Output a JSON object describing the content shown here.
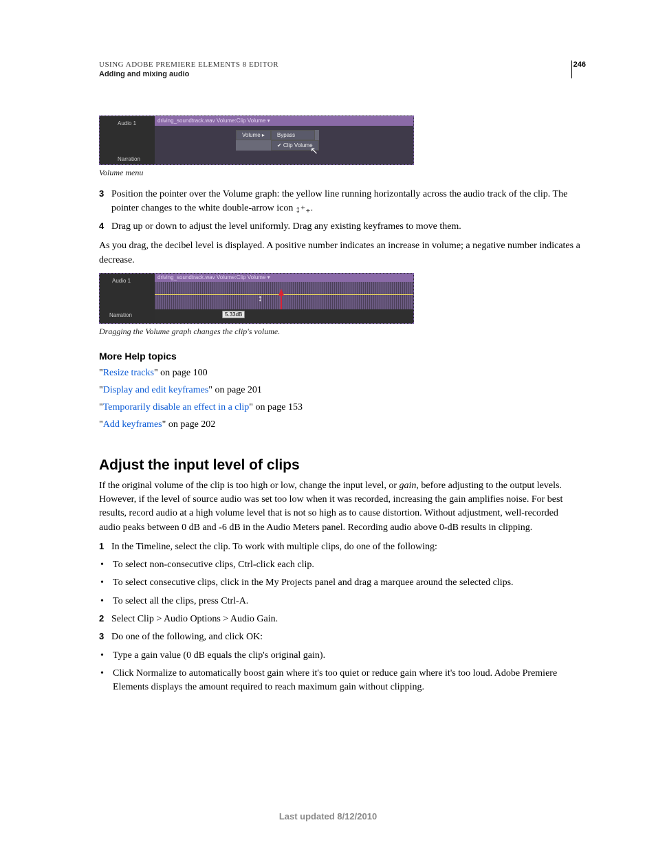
{
  "header": {
    "title": "USING ADOBE PREMIERE ELEMENTS 8 EDITOR",
    "subtitle": "Adding and mixing audio",
    "page_number": "246"
  },
  "fig1": {
    "track_audio": "Audio 1",
    "track_narration": "Narration",
    "clip_label": "driving_soundtrack.wav Volume:Clip Volume ▾",
    "menu_volume": "Volume ▸",
    "menu_bypass": "Bypass",
    "menu_clip_volume": "Clip Volume",
    "caption": "Volume menu"
  },
  "step3": {
    "num": "3",
    "text_a": "Position the pointer over the Volume graph: the yellow line running horizontally across the audio track of the clip. The pointer changes to the white double-arrow icon ",
    "text_b": "."
  },
  "step4": {
    "num": "4",
    "text": "Drag up or down to adjust the level uniformly. Drag any existing keyframes to move them."
  },
  "para_decibel": "As you drag, the decibel level is displayed. A positive number indicates an increase in volume; a negative number indicates a decrease.",
  "fig2": {
    "track_audio": "Audio 1",
    "track_narration": "Narration",
    "clip_label": "driving_soundtrack.wav Volume:Clip Volume ▾",
    "db": "5.33dB",
    "caption": "Dragging the Volume graph changes the clip's volume."
  },
  "help": {
    "heading": "More Help topics",
    "items": [
      {
        "link": "Resize tracks",
        "rest": "\" on page 100"
      },
      {
        "link": "Display and edit keyframes",
        "rest": "\" on page 201"
      },
      {
        "link": "Temporarily disable an effect in a clip",
        "rest": "\" on page 153"
      },
      {
        "link": "Add keyframes",
        "rest": "\" on page 202"
      }
    ],
    "quote": "\""
  },
  "section2": {
    "heading": "Adjust the input level of clips",
    "intro_a": "If the original volume of the clip is too high or low, change the input level, or ",
    "intro_gain": "gain",
    "intro_b": ", before adjusting to the output levels. However, if the level of source audio was set too low when it was recorded, increasing the gain amplifies noise. For best results, record audio at a high volume level that is not so high as to cause distortion. Without adjustment, well-recorded audio peaks between 0 dB and -6 dB in the Audio Meters panel. Recording audio above 0-dB results in clipping.",
    "steps": [
      {
        "n": "1",
        "t": "In the Timeline, select the clip. To work with multiple clips, do one of the following:"
      },
      {
        "b": "•",
        "t": "To select non-consecutive clips, Ctrl-click each clip."
      },
      {
        "b": "•",
        "t": "To select consecutive clips, click in the My Projects panel and drag a marquee around the selected clips."
      },
      {
        "b": "•",
        "t": "To select all the clips, press Ctrl-A."
      },
      {
        "n": "2",
        "t": "Select Clip > Audio Options > Audio Gain."
      },
      {
        "n": "3",
        "t": "Do one of the following, and click OK:"
      },
      {
        "b": "•",
        "t": "Type a gain value (0 dB equals the clip's original gain)."
      },
      {
        "b": "•",
        "t": "Click Normalize to automatically boost gain where it's too quiet or reduce gain where it's too loud. Adobe Premiere Elements displays the amount required to reach maximum gain without clipping."
      }
    ]
  },
  "footer": "Last updated 8/12/2010"
}
